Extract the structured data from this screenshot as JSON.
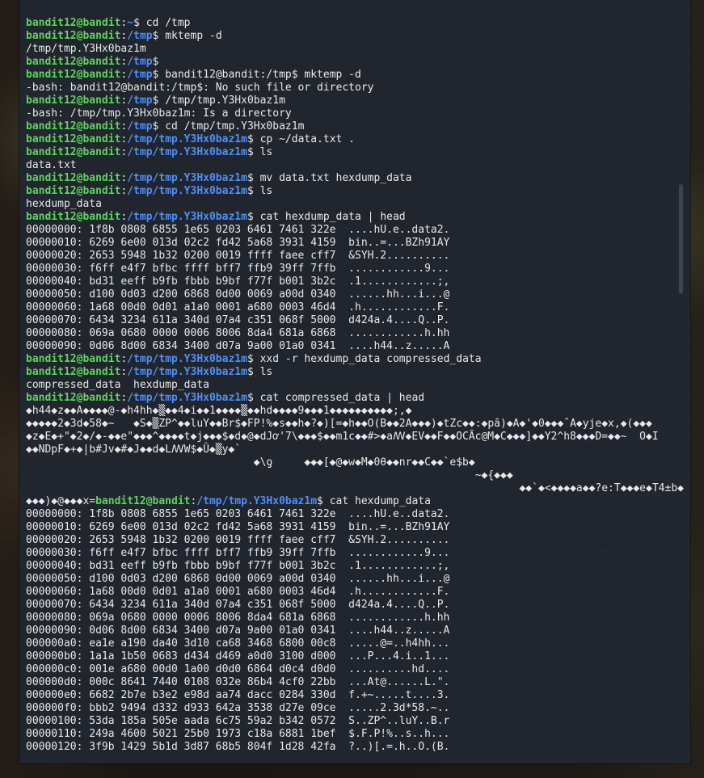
{
  "terminal": {
    "lines": [
      {
        "type": "prompt",
        "user": "bandit12@bandit",
        "sep": ":",
        "path": "~",
        "sym": "$ ",
        "cmd": "cd /tmp"
      },
      {
        "type": "prompt",
        "user": "bandit12@bandit",
        "sep": ":",
        "path": "/tmp",
        "sym": "$ ",
        "cmd": "mktemp -d"
      },
      {
        "type": "output",
        "text": "/tmp/tmp.Y3Hx0baz1m"
      },
      {
        "type": "prompt",
        "user": "bandit12@bandit",
        "sep": ":",
        "path": "/tmp",
        "sym": "$",
        "cmd": ""
      },
      {
        "type": "prompt",
        "user": "bandit12@bandit",
        "sep": ":",
        "path": "/tmp",
        "sym": "$ ",
        "cmd": "bandit12@bandit:/tmp$ mktemp -d"
      },
      {
        "type": "output",
        "text": "-bash: bandit12@bandit:/tmp$: No such file or directory"
      },
      {
        "type": "prompt",
        "user": "bandit12@bandit",
        "sep": ":",
        "path": "/tmp",
        "sym": "$ ",
        "cmd": "/tmp/tmp.Y3Hx0baz1m"
      },
      {
        "type": "output",
        "text": "-bash: /tmp/tmp.Y3Hx0baz1m: Is a directory"
      },
      {
        "type": "prompt",
        "user": "bandit12@bandit",
        "sep": ":",
        "path": "/tmp",
        "sym": "$ ",
        "cmd": "cd /tmp/tmp.Y3Hx0baz1m"
      },
      {
        "type": "prompt",
        "user": "bandit12@bandit",
        "sep": ":",
        "path": "/tmp/tmp.Y3Hx0baz1m",
        "sym": "$ ",
        "cmd": "cp ~/data.txt ."
      },
      {
        "type": "prompt",
        "user": "bandit12@bandit",
        "sep": ":",
        "path": "/tmp/tmp.Y3Hx0baz1m",
        "sym": "$ ",
        "cmd": "ls"
      },
      {
        "type": "output",
        "text": "data.txt"
      },
      {
        "type": "prompt",
        "user": "bandit12@bandit",
        "sep": ":",
        "path": "/tmp/tmp.Y3Hx0baz1m",
        "sym": "$ ",
        "cmd": "mv data.txt hexdump_data"
      },
      {
        "type": "prompt",
        "user": "bandit12@bandit",
        "sep": ":",
        "path": "/tmp/tmp.Y3Hx0baz1m",
        "sym": "$ ",
        "cmd": "ls"
      },
      {
        "type": "output",
        "text": "hexdump_data"
      },
      {
        "type": "prompt",
        "user": "bandit12@bandit",
        "sep": ":",
        "path": "/tmp/tmp.Y3Hx0baz1m",
        "sym": "$ ",
        "cmd": "cat hexdump_data | head"
      },
      {
        "type": "output",
        "text": "00000000: 1f8b 0808 6855 1e65 0203 6461 7461 322e  ....hU.e..data2."
      },
      {
        "type": "output",
        "text": "00000010: 6269 6e00 013d 02c2 fd42 5a68 3931 4159  bin..=...BZh91AY"
      },
      {
        "type": "output",
        "text": "00000020: 2653 5948 1b32 0200 0019 ffff faee cff7  &SYH.2.........."
      },
      {
        "type": "output",
        "text": "00000030: f6ff e4f7 bfbc ffff bff7 ffb9 39ff 7ffb  ............9..."
      },
      {
        "type": "output",
        "text": "00000040: bd31 eeff b9fb fbbb b9bf f77f b001 3b2c  .1............;,"
      },
      {
        "type": "output",
        "text": "00000050: d100 0d03 d200 6868 0d00 0069 a00d 0340  ......hh...i...@"
      },
      {
        "type": "output",
        "text": "00000060: 1a68 00d0 0d01 a1a0 0001 a680 0003 46d4  .h............F."
      },
      {
        "type": "output",
        "text": "00000070: 6434 3234 611a 340d 07a4 c351 068f 5000  d424a.4....Q..P."
      },
      {
        "type": "output",
        "text": "00000080: 069a 0680 0000 0006 8006 8da4 681a 6868  ............h.hh"
      },
      {
        "type": "output",
        "text": "00000090: 0d06 8d00 6834 3400 d07a 9a00 01a0 0341  ....h44..z.....A"
      },
      {
        "type": "prompt",
        "user": "bandit12@bandit",
        "sep": ":",
        "path": "/tmp/tmp.Y3Hx0baz1m",
        "sym": "$ ",
        "cmd": "xxd -r hexdump_data compressed_data"
      },
      {
        "type": "prompt",
        "user": "bandit12@bandit",
        "sep": ":",
        "path": "/tmp/tmp.Y3Hx0baz1m",
        "sym": "$ ",
        "cmd": "ls"
      },
      {
        "type": "output",
        "text": "compressed_data  hexdump_data"
      },
      {
        "type": "prompt",
        "user": "bandit12@bandit",
        "sep": ":",
        "path": "/tmp/tmp.Y3Hx0baz1m",
        "sym": "$ ",
        "cmd": "cat compressed_data | head"
      },
      {
        "type": "output",
        "text": "◆h44◆z◆◆A◆◆◆◆@-◆h4hh◆▒◆◆4◆i◆◆1◆◆◆◆▒◆◆hd◆◆◆◆9◆◆◆1◆◆◆◆◆◆◆◆◆◆;,◆"
      },
      {
        "type": "output",
        "text": "◆◆◆◆◆2◆3d◆58◆~   ◆S◆▒ZP^◆◆luY◆◆Br$◆FP!%◆s◆◆h◆?◆)[=◆h◆◆O(B◆◆2A◆◆◆)◆tZc◆◆:◆pā)◆A◆'◆0◆◆◆ˆA◆yje◆x,◆(◆◆◆"
      },
      {
        "type": "output",
        "text": "◆z◆E◆+\"◆2◆/◆-◆◆e\"◆◆◆^◆◆◆◆t◆j◆◆◆$◆d◆@◆dJơ'7\\◆◆◆$◆◆m1c◆◆#>◆aꟿ◆EV◆◆F◆◆OCÃc@M◆C◆◆◆]◆◆Y2^h8◆◆◆D=◆◆~  O◆I"
      },
      {
        "type": "output",
        "text": "◆◆NDpF◆+◆|b#Jv◆#◆J◆◆d◆LꟿW$◆Û◆▒y◆`"
      },
      {
        "type": "output",
        "text": "                                    ◆\\ƍ     ◆◆◆[◆@◆w◆M◆0θ◆◆nr◆◆C◆◆`e$b◆"
      },
      {
        "type": "output",
        "text": "                                                                       ~◆{◆◆◆"
      },
      {
        "type": "output",
        "text": "                                                                              ◆◆`◆<◆◆◆◆a◆◆?e:T◆◆◆e◆T4±b◆"
      },
      {
        "type": "prompt",
        "pre": "◆◆◆)◆@◆◆◆x=",
        "user": "bandit12@bandit",
        "sep": ":",
        "path": "/tmp/tmp.Y3Hx0baz1m",
        "sym": "$ ",
        "cmd": "cat hexdump_data"
      },
      {
        "type": "output",
        "text": "00000000: 1f8b 0808 6855 1e65 0203 6461 7461 322e  ....hU.e..data2."
      },
      {
        "type": "output",
        "text": "00000010: 6269 6e00 013d 02c2 fd42 5a68 3931 4159  bin..=...BZh91AY"
      },
      {
        "type": "output",
        "text": "00000020: 2653 5948 1b32 0200 0019 ffff faee cff7  &SYH.2.........."
      },
      {
        "type": "output",
        "text": "00000030: f6ff e4f7 bfbc ffff bff7 ffb9 39ff 7ffb  ............9..."
      },
      {
        "type": "output",
        "text": "00000040: bd31 eeff b9fb fbbb b9bf f77f b001 3b2c  .1............;,"
      },
      {
        "type": "output",
        "text": "00000050: d100 0d03 d200 6868 0d00 0069 a00d 0340  ......hh...i...@"
      },
      {
        "type": "output",
        "text": "00000060: 1a68 00d0 0d01 a1a0 0001 a680 0003 46d4  .h............F."
      },
      {
        "type": "output",
        "text": "00000070: 6434 3234 611a 340d 07a4 c351 068f 5000  d424a.4....Q..P."
      },
      {
        "type": "output",
        "text": "00000080: 069a 0680 0000 0006 8006 8da4 681a 6868  ............h.hh"
      },
      {
        "type": "output",
        "text": "00000090: 0d06 8d00 6834 3400 d07a 9a00 01a0 0341  ....h44..z.....A"
      },
      {
        "type": "output",
        "text": "000000a0: ea1e a190 da40 3d10 ca68 3468 6800 00c8  .....@=..h4hh..."
      },
      {
        "type": "output",
        "text": "000000b0: 1a1a 1b50 0683 d434 d469 a0d0 3100 d000  ...P...4.i..1..."
      },
      {
        "type": "output",
        "text": "000000c0: 001e a680 00d0 1a00 d0d0 6864 d0c4 d0d0  ..........hd...."
      },
      {
        "type": "output",
        "text": "000000d0: 000c 8641 7440 0108 032e 86b4 4cf0 22bb  ...At@......L.\"."
      },
      {
        "type": "output",
        "text": "000000e0: 6682 2b7e b3e2 e98d aa74 dacc 0284 330d  f.+~.....t....3."
      },
      {
        "type": "output",
        "text": "000000f0: bbb2 9494 d332 d933 642a 3538 d27e 09ce  .....2.3d*58.~.."
      },
      {
        "type": "output",
        "text": "00000100: 53da 185a 505e aada 6c75 59a2 b342 0572  S..ZP^..luY..B.r"
      },
      {
        "type": "output",
        "text": "00000110: 249a 4600 5021 25b0 1973 c18a 6881 1bef  $.F.P!%..s..h..."
      },
      {
        "type": "output",
        "text": "00000120: 3f9b 1429 5b1d 3d87 68b5 804f 1d28 42fa  ?..)[.=.h..O.(B."
      }
    ]
  },
  "colors": {
    "user": "#5fd35f",
    "path": "#4f8ff7",
    "text": "#e8e8e8",
    "background": "#212630"
  }
}
